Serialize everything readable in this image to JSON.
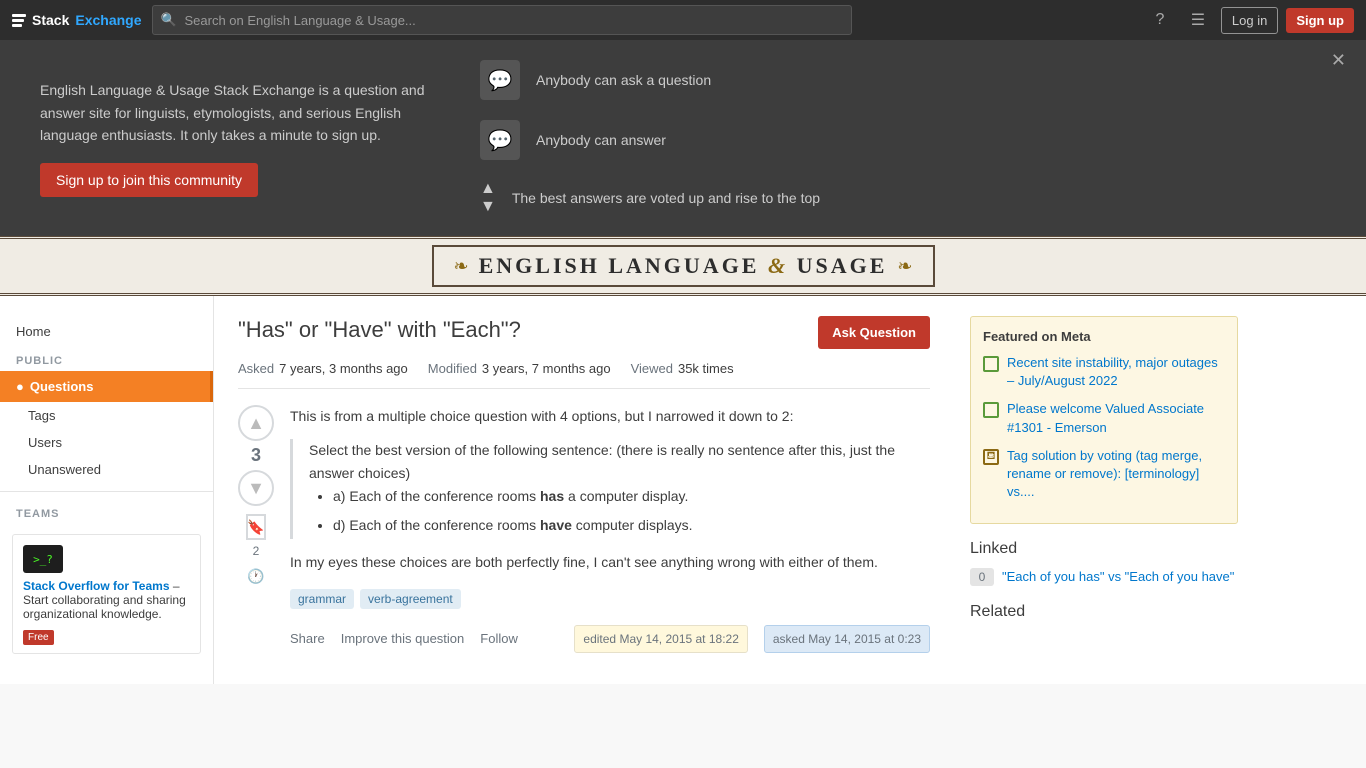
{
  "site": {
    "name": "Stack Exchange",
    "title_part1": "Stack",
    "title_part2": "Exchange"
  },
  "topnav": {
    "search_placeholder": "Search on English Language & Usage...",
    "login_label": "Log in",
    "signup_label": "Sign up"
  },
  "hero": {
    "description": "English Language & Usage Stack Exchange is a question and answer site for linguists, etymologists, and serious English language enthusiasts. It only takes a minute to sign up.",
    "join_button": "Sign up to join this community",
    "feature1": "Anybody can ask a question",
    "feature2": "Anybody can answer",
    "feature3": "The best answers are voted up and rise to the top"
  },
  "site_header": {
    "title_part1": "ENGLISH LANGUAGE",
    "ampersand": "&",
    "title_part2": "USAGE",
    "deco_left": "❧",
    "deco_right": "❧"
  },
  "sidebar": {
    "home_label": "Home",
    "public_label": "PUBLIC",
    "questions_label": "Questions",
    "tags_label": "Tags",
    "users_label": "Users",
    "unanswered_label": "Unanswered",
    "teams_label": "TEAMS",
    "teams_box_title": "Stack Overflow for Teams",
    "teams_box_link": "Stack Overflow for Teams",
    "teams_box_dash": "–",
    "teams_box_desc": "Start collaborating and sharing organizational knowledge.",
    "teams_badge": "Free",
    "teams_terminal": ">_?"
  },
  "question": {
    "title": "\"Has\" or \"Have\" with \"Each\"?",
    "ask_button": "Ask Question",
    "meta_asked_label": "Asked",
    "meta_asked_value": "7 years, 3 months ago",
    "meta_modified_label": "Modified",
    "meta_modified_value": "3 years, 7 months ago",
    "meta_viewed_label": "Viewed",
    "meta_viewed_value": "35k times",
    "vote_count": "3",
    "bookmark_count": "2",
    "body_intro": "This is from a multiple choice question with 4 options, but I narrowed it down to 2:",
    "blockquote": "Select the best version of the following sentence: (there is really no sentence after this, just the answer choices)",
    "list_item_a": "a) Each of the conference rooms ",
    "list_item_a_bold": "has",
    "list_item_a_suffix": " a computer display.",
    "list_item_d": "d) Each of the conference rooms ",
    "list_item_d_bold": "have",
    "list_item_d_suffix": " computer displays.",
    "body_conclusion": "In my eyes these choices are both perfectly fine, I can't see anything wrong with either of them.",
    "tag1": "grammar",
    "tag2": "verb-agreement",
    "share_label": "Share",
    "improve_label": "Improve this question",
    "follow_label": "Follow",
    "edited_label": "edited",
    "edited_date": "May 14, 2015 at 18:22",
    "asked_label": "asked",
    "asked_date": "May 14, 2015 at 0:23"
  },
  "right_sidebar": {
    "featured_meta_title": "Featured on Meta",
    "meta_item1": "Recent site instability, major outages – July/August 2022",
    "meta_item2": "Please welcome Valued Associate #1301 - Emerson",
    "meta_item3": "Tag solution by voting (tag merge, rename or remove): [terminology] vs....",
    "linked_title": "Linked",
    "linked_score": "0",
    "linked_item1": "\"Each of you has\" vs \"Each of you have\"",
    "related_title": "Related"
  }
}
